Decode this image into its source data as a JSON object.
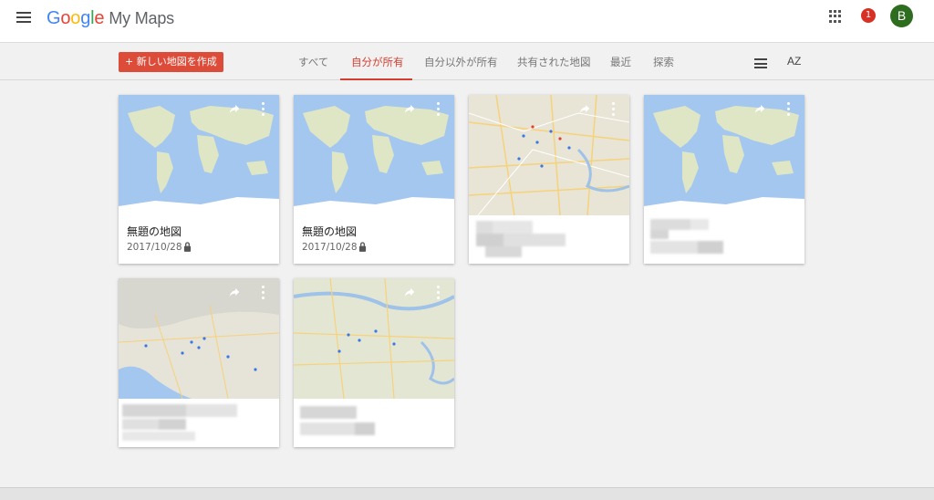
{
  "app": {
    "logo_google": [
      "G",
      "o",
      "o",
      "g",
      "l",
      "e"
    ],
    "product_name": "My Maps",
    "notification_count": "1",
    "avatar_letter": "B"
  },
  "toolbar": {
    "create_button": "+ 新しい地図を作成",
    "tabs": [
      {
        "label": "すべて",
        "active": false
      },
      {
        "label": "自分が所有",
        "active": true
      },
      {
        "label": "自分以外が所有",
        "active": false
      },
      {
        "label": "共有された地図",
        "active": false
      },
      {
        "label": "最近",
        "active": false
      },
      {
        "label": "探索",
        "active": false
      }
    ],
    "sort_label": "AZ"
  },
  "cards": [
    {
      "title": "無題の地図",
      "date": "2017/10/28",
      "thumbnail": "world-map",
      "private": true
    },
    {
      "title": "無題の地図",
      "date": "2017/10/28",
      "thumbnail": "world-map",
      "private": true
    },
    {
      "title": "",
      "date": "",
      "thumbnail": "city-map",
      "redacted": true
    },
    {
      "title": "",
      "date": "",
      "thumbnail": "world-map",
      "redacted": true
    },
    {
      "title": "",
      "date": "",
      "thumbnail": "region-map",
      "redacted": true
    },
    {
      "title": "",
      "date": "",
      "thumbnail": "city-map",
      "redacted": true
    }
  ],
  "colors": {
    "accent": "#d23f31",
    "create_button": "#dd4b39",
    "avatar": "#2e6d1f",
    "notification": "#d93025",
    "ocean": "#a4c7f0",
    "land": "#dfe6c6"
  },
  "icons": [
    "menu-icon",
    "apps-grid-icon",
    "list-view-icon",
    "share-icon",
    "more-vert-icon",
    "lock-icon"
  ]
}
